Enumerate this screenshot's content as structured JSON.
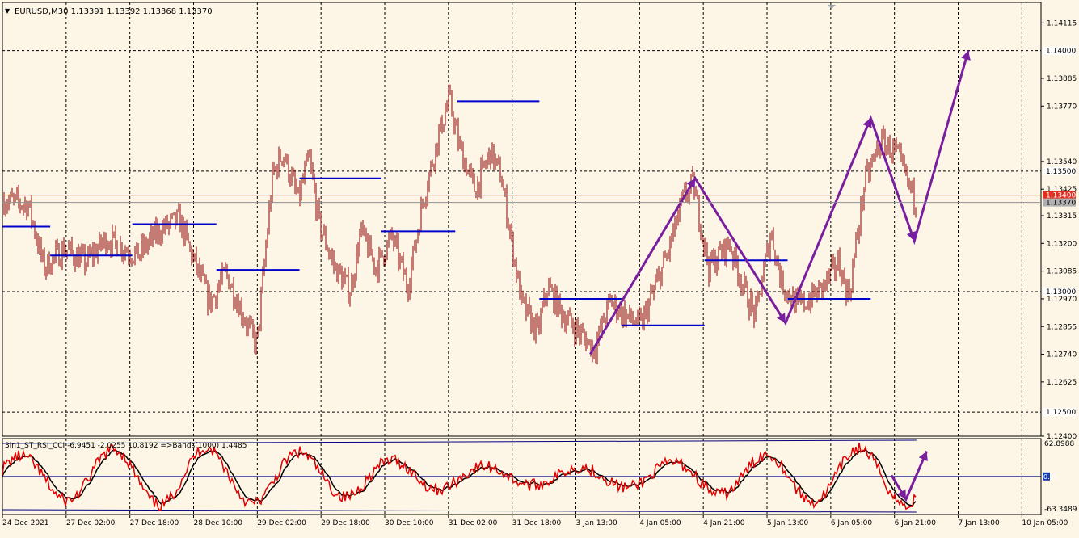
{
  "header": {
    "symbol_caret": "▼",
    "title": "EURUSD,M30  1.13391 1.13392 1.13368 1.13370"
  },
  "indicator": {
    "title": "3in1_ST_RSI_CCI -6.9451 -2.0255 10.8192  =>Bands(1000) 1.4485",
    "scale_top": "62.8988",
    "scale_mid": "0.00",
    "scale_bottom": "-63.3489"
  },
  "colors": {
    "background": "#fdf6e6",
    "grid": "#000000",
    "candles": "#8b0000",
    "levels": "#0000cc",
    "zigzag": "#7a1ea0",
    "price_line": "#e03020",
    "bid_line": "#909090",
    "osc_fast": "#e00000",
    "osc_slow": "#000000",
    "osc_bands": "#000080"
  },
  "chart_data": {
    "type": "candlestick",
    "symbol": "EURUSD",
    "timeframe": "M30",
    "ohlc_last": {
      "open": 1.13391,
      "high": 1.13392,
      "low": 1.13368,
      "close": 1.1337
    },
    "ylim": [
      1.124,
      1.142
    ],
    "y_ticks": [
      "1.14115",
      "1.13885",
      "1.13770",
      "1.13540",
      "1.13425",
      "1.13315",
      "1.13200",
      "1.13085",
      "1.12970",
      "1.12855",
      "1.12740",
      "1.12625",
      "1.12400"
    ],
    "horizontal_levels": [
      "1.14000",
      "1.13500",
      "1.13000",
      "1.12500"
    ],
    "current_price_label": "1.13400",
    "bid_price_label": "1.13370",
    "x_labels": [
      "24 Dec 2021",
      "27 Dec 02:00",
      "27 Dec 18:00",
      "28 Dec 10:00",
      "29 Dec 02:00",
      "29 Dec 18:00",
      "30 Dec 10:00",
      "31 Dec 02:00",
      "31 Dec 18:00",
      "3 Jan 13:00",
      "4 Jan 05:00",
      "4 Jan 21:00",
      "5 Jan 13:00",
      "6 Jan 05:00",
      "6 Jan 21:00",
      "7 Jan 13:00",
      "10 Jan 05:00"
    ],
    "price_path": [
      [
        0,
        1.1338
      ],
      [
        0.025,
        1.1336
      ],
      [
        0.04,
        1.131
      ],
      [
        0.06,
        1.1318
      ],
      [
        0.08,
        1.1312
      ],
      [
        0.1,
        1.1322
      ],
      [
        0.13,
        1.1315
      ],
      [
        0.15,
        1.1325
      ],
      [
        0.17,
        1.133
      ],
      [
        0.185,
        1.1312
      ],
      [
        0.2,
        1.1295
      ],
      [
        0.215,
        1.1308
      ],
      [
        0.235,
        1.1287
      ],
      [
        0.245,
        1.1278
      ],
      [
        0.26,
        1.1348
      ],
      [
        0.27,
        1.1358
      ],
      [
        0.285,
        1.1338
      ],
      [
        0.295,
        1.1356
      ],
      [
        0.305,
        1.1328
      ],
      [
        0.32,
        1.131
      ],
      [
        0.335,
        1.13
      ],
      [
        0.345,
        1.1325
      ],
      [
        0.36,
        1.131
      ],
      [
        0.375,
        1.1323
      ],
      [
        0.39,
        1.1302
      ],
      [
        0.405,
        1.1338
      ],
      [
        0.42,
        1.1365
      ],
      [
        0.43,
        1.138
      ],
      [
        0.44,
        1.136
      ],
      [
        0.455,
        1.1342
      ],
      [
        0.47,
        1.1358
      ],
      [
        0.48,
        1.1348
      ],
      [
        0.5,
        1.1295
      ],
      [
        0.515,
        1.1283
      ],
      [
        0.525,
        1.1302
      ],
      [
        0.54,
        1.129
      ],
      [
        0.555,
        1.1283
      ],
      [
        0.57,
        1.1276
      ],
      [
        0.585,
        1.1296
      ],
      [
        0.6,
        1.129
      ],
      [
        0.615,
        1.1286
      ],
      [
        0.625,
        1.1298
      ],
      [
        0.64,
        1.1315
      ],
      [
        0.655,
        1.1338
      ],
      [
        0.665,
        1.1345
      ],
      [
        0.68,
        1.131
      ],
      [
        0.7,
        1.132
      ],
      [
        0.715,
        1.13
      ],
      [
        0.725,
        1.129
      ],
      [
        0.74,
        1.1325
      ],
      [
        0.75,
        1.1304
      ],
      [
        0.765,
        1.1294
      ],
      [
        0.775,
        1.1296
      ],
      [
        0.79,
        1.1302
      ],
      [
        0.805,
        1.1312
      ],
      [
        0.815,
        1.1298
      ],
      [
        0.83,
        1.1345
      ],
      [
        0.845,
        1.1362
      ],
      [
        0.86,
        1.1358
      ],
      [
        0.872,
        1.1345
      ],
      [
        0.88,
        1.1337
      ]
    ],
    "blue_levels": [
      {
        "x0": 0.0,
        "x1": 0.046,
        "price": 1.1327
      },
      {
        "x0": 0.046,
        "x1": 0.125,
        "price": 1.1315
      },
      {
        "x0": 0.125,
        "x1": 0.206,
        "price": 1.1328
      },
      {
        "x0": 0.206,
        "x1": 0.286,
        "price": 1.1309
      },
      {
        "x0": 0.286,
        "x1": 0.365,
        "price": 1.1347
      },
      {
        "x0": 0.365,
        "x1": 0.436,
        "price": 1.1325
      },
      {
        "x0": 0.438,
        "x1": 0.517,
        "price": 1.1379
      },
      {
        "x0": 0.517,
        "x1": 0.596,
        "price": 1.1297
      },
      {
        "x0": 0.596,
        "x1": 0.676,
        "price": 1.1286
      },
      {
        "x0": 0.676,
        "x1": 0.756,
        "price": 1.1313
      },
      {
        "x0": 0.756,
        "x1": 0.836,
        "price": 1.1297
      }
    ],
    "zigzag": [
      [
        0.566,
        1.1274
      ],
      [
        0.667,
        1.1347
      ],
      [
        0.754,
        1.1287
      ],
      [
        0.836,
        1.1372
      ],
      [
        0.878,
        1.1321
      ],
      [
        0.93,
        1.14
      ]
    ],
    "oscillator": {
      "ylim": [
        -63.3489,
        62.8988
      ],
      "bands": [
        62.8988,
        -63.3489
      ],
      "projection": [
        [
          0.856,
          2
        ],
        [
          0.87,
          -38
        ],
        [
          0.89,
          42
        ]
      ]
    }
  }
}
